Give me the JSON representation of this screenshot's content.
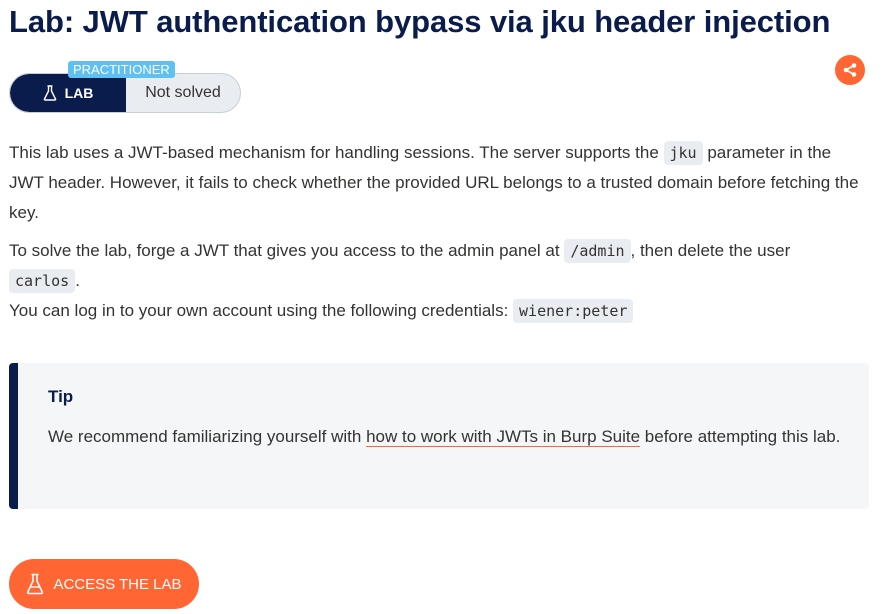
{
  "page": {
    "title": "Lab: JWT authentication bypass via jku header injection"
  },
  "badge": {
    "level": "PRACTITIONER",
    "type_label": "LAB",
    "status": "Not solved"
  },
  "description": {
    "p1_a": "This lab uses a JWT-based mechanism for handling sessions. The server supports the ",
    "p1_code": "jku",
    "p1_b": " parameter in the JWT header. However, it fails to check whether the provided URL belongs to a trusted domain before fetching the key.",
    "p2_a": "To solve the lab, forge a JWT that gives you access to the admin panel at ",
    "p2_code1": "/admin",
    "p2_b": ", then delete the user ",
    "p2_code2": "carlos",
    "p2_c": ".",
    "p3_a": "You can log in to your own account using the following credentials: ",
    "p3_code": "wiener:peter"
  },
  "tip": {
    "title": "Tip",
    "text_a": "We recommend familiarizing yourself with ",
    "link": "how to work with JWTs in Burp Suite",
    "text_b": " before attempting this lab."
  },
  "cta": {
    "label": "ACCESS THE LAB"
  },
  "icons": {
    "share": "share-icon",
    "flask": "flask-icon"
  },
  "colors": {
    "brand_navy": "#0a1c4b",
    "accent_orange": "#ff6633",
    "level_blue": "#5fc0f2"
  }
}
